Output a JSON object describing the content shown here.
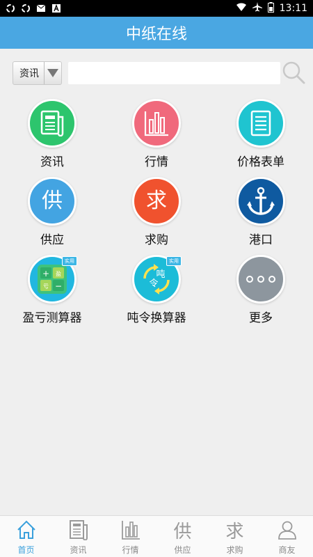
{
  "status_bar": {
    "time": "13:11",
    "icons": [
      "sync-icon",
      "sync-icon",
      "mail-icon",
      "font-icon"
    ],
    "right_icons": [
      "wifi-icon",
      "airplane-icon",
      "battery-icon"
    ]
  },
  "header": {
    "title": "中纸在线"
  },
  "search": {
    "category": "资讯",
    "placeholder": "",
    "value": ""
  },
  "grid": [
    {
      "label": "资讯",
      "icon": "news-icon",
      "color": "#2dc56d"
    },
    {
      "label": "行情",
      "icon": "bar-chart-icon",
      "color": "#f0697c"
    },
    {
      "label": "价格表单",
      "icon": "list-document-icon",
      "color": "#1fc4d0"
    },
    {
      "label": "供应",
      "icon": "supply-icon",
      "glyph": "供",
      "color": "#43a4e2"
    },
    {
      "label": "求购",
      "icon": "purchase-icon",
      "glyph": "求",
      "color": "#f0522e"
    },
    {
      "label": "港口",
      "icon": "anchor-icon",
      "color": "#0f5aa0"
    },
    {
      "label": "盈亏测算器",
      "icon": "calculator-icon",
      "color": "#3ec27c",
      "badge": "实用",
      "calc": [
        "+",
        "盈",
        "亏",
        "−"
      ]
    },
    {
      "label": "吨令换算器",
      "icon": "convert-icon",
      "color": "#1cbcd8",
      "badge": "实用",
      "calc": [
        "吨",
        "令"
      ]
    },
    {
      "label": "更多",
      "icon": "more-icon",
      "color": "#8d969e"
    }
  ],
  "tabs": [
    {
      "label": "首页",
      "icon": "home-icon",
      "active": true
    },
    {
      "label": "资讯",
      "icon": "news-icon",
      "active": false
    },
    {
      "label": "行情",
      "icon": "bar-chart-icon",
      "active": false
    },
    {
      "label": "供应",
      "icon": "supply-icon",
      "glyph": "供",
      "active": false
    },
    {
      "label": "求购",
      "icon": "purchase-icon",
      "glyph": "求",
      "active": false
    },
    {
      "label": "商友",
      "icon": "contacts-icon",
      "active": false
    }
  ]
}
